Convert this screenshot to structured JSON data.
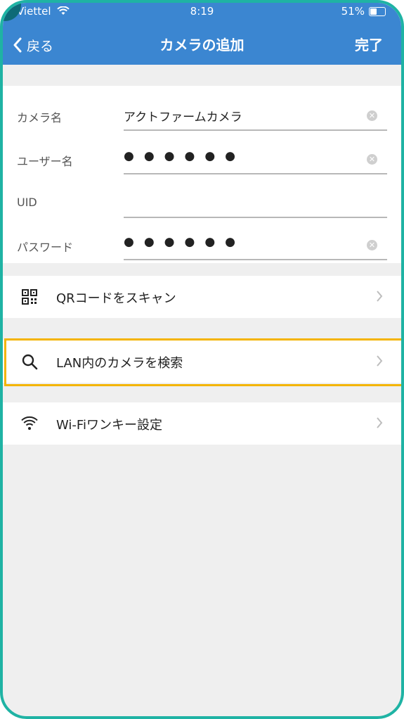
{
  "status": {
    "carrier": "Viettel",
    "time": "8:19",
    "battery": "51%",
    "battery_level": 0.51
  },
  "nav": {
    "back_label": "戻る",
    "title": "カメラの追加",
    "done_label": "完了"
  },
  "form": {
    "camera_name": {
      "label": "カメラ名",
      "value": "アクトファームカメラ"
    },
    "username": {
      "label": "ユーザー名",
      "value": "●●●●●●"
    },
    "uid": {
      "label": "UID",
      "value": ""
    },
    "password": {
      "label": "パスワード",
      "value": "●●●●●●"
    }
  },
  "menu": {
    "qr": {
      "label": "QRコードをスキャン",
      "icon": "qr-code-icon"
    },
    "lan": {
      "label": "LAN内のカメラを検索",
      "icon": "search-icon"
    },
    "wifi": {
      "label": "Wi-Fiワンキー設定",
      "icon": "wifi-icon"
    }
  },
  "colors": {
    "navbar": "#3b86d1",
    "highlight": "#f4b400",
    "frame": "#1fb3a4"
  }
}
